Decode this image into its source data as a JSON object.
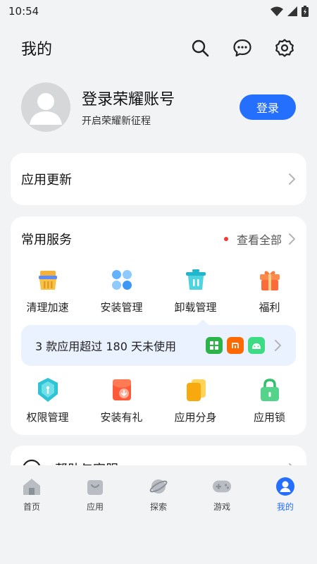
{
  "status": {
    "time": "10:54"
  },
  "header": {
    "title": "我的"
  },
  "profile": {
    "name": "登录荣耀账号",
    "subtitle": "开启荣耀新征程",
    "login_label": "登录"
  },
  "update_card": {
    "title": "应用更新"
  },
  "services": {
    "title": "常用服务",
    "view_all": "查看全部",
    "row1": [
      {
        "label": "清理加速",
        "icon": "broom-icon"
      },
      {
        "label": "安装管理",
        "icon": "clover-icon"
      },
      {
        "label": "卸载管理",
        "icon": "trash-icon"
      },
      {
        "label": "福利",
        "icon": "gift-icon"
      }
    ],
    "notice": "3 款应用超过 180 天未使用",
    "row2": [
      {
        "label": "权限管理",
        "icon": "shield-lock-icon"
      },
      {
        "label": "安装有礼",
        "icon": "red-packet-icon"
      },
      {
        "label": "应用分身",
        "icon": "clone-icon"
      },
      {
        "label": "应用锁",
        "icon": "lock-icon"
      }
    ]
  },
  "help": {
    "title": "帮助与客服"
  },
  "tabs": [
    {
      "label": "首页",
      "icon": "home-icon"
    },
    {
      "label": "应用",
      "icon": "app-bag-icon"
    },
    {
      "label": "探索",
      "icon": "planet-icon"
    },
    {
      "label": "游戏",
      "icon": "gamepad-icon"
    },
    {
      "label": "我的",
      "icon": "profile-icon",
      "active": true
    }
  ],
  "colors": {
    "accent": "#256fff",
    "background": "#f1f3f5",
    "card": "#ffffff",
    "dot": "#f23b30"
  }
}
